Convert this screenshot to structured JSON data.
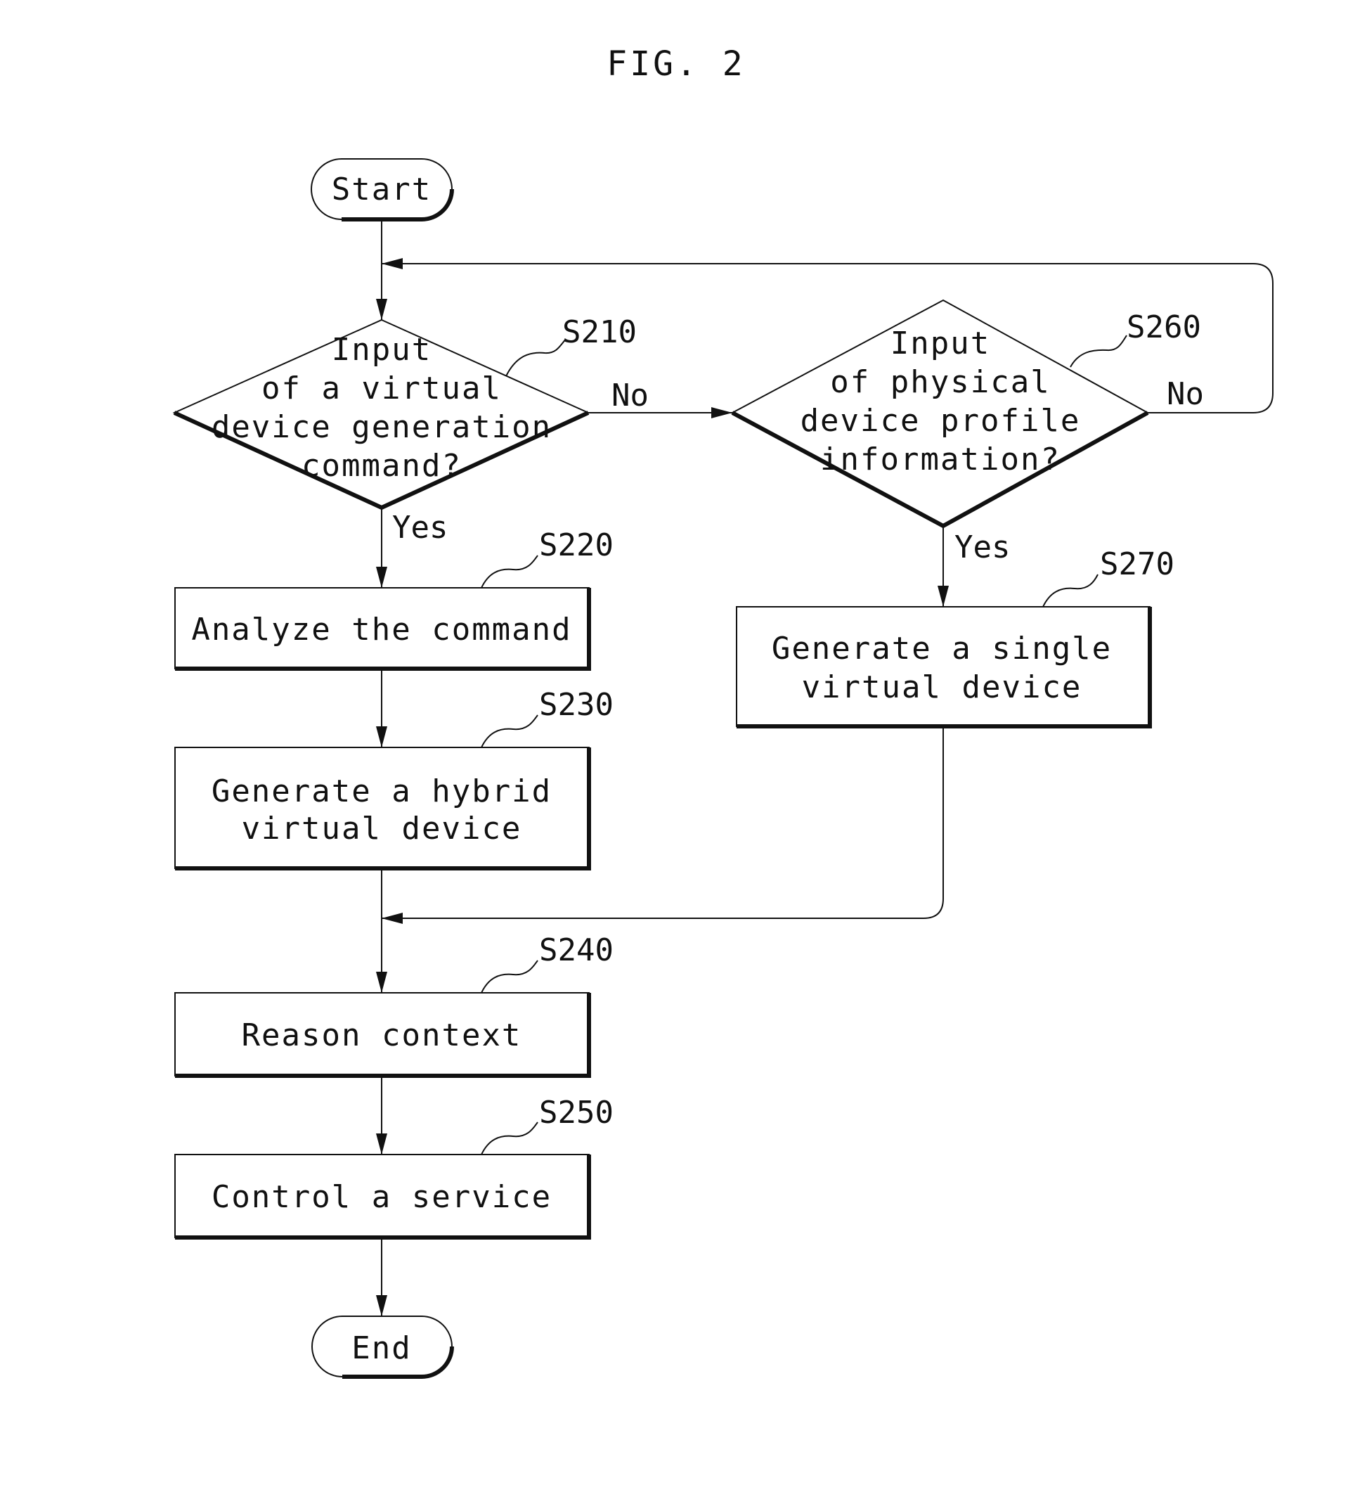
{
  "figure": {
    "title": "FIG. 2"
  },
  "terminals": {
    "start": "Start",
    "end": "End"
  },
  "decisions": [
    {
      "id": "S210",
      "lines": [
        "Input",
        "of a virtual",
        "device generation",
        "command?"
      ],
      "yes_label": "Yes",
      "no_label": "No"
    },
    {
      "id": "S260",
      "lines": [
        "Input",
        "of physical",
        "device profile",
        "information?"
      ],
      "yes_label": "Yes",
      "no_label": "No"
    }
  ],
  "processes": [
    {
      "id": "S220",
      "lines": [
        "Analyze the command"
      ]
    },
    {
      "id": "S230",
      "lines": [
        "Generate a hybrid",
        "virtual device"
      ]
    },
    {
      "id": "S240",
      "lines": [
        "Reason context"
      ]
    },
    {
      "id": "S250",
      "lines": [
        "Control a service"
      ]
    },
    {
      "id": "S270",
      "lines": [
        "Generate a single",
        "virtual device"
      ]
    }
  ]
}
